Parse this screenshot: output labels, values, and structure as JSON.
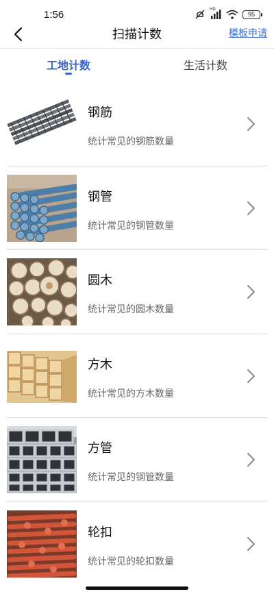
{
  "status_bar": {
    "time": "1:56",
    "battery": "95",
    "network_label": "HD",
    "icons": [
      "mute-icon",
      "signal-icon",
      "wifi-icon",
      "battery-icon"
    ]
  },
  "nav": {
    "back_icon": "chevron-left-icon",
    "title": "扫描计数",
    "template_link": "模板申请"
  },
  "tabs": [
    {
      "label": "工地计数",
      "active": true
    },
    {
      "label": "生活计数",
      "active": false
    }
  ],
  "colors": {
    "accent": "#3a63c4",
    "link": "#3b6fd8"
  },
  "items": [
    {
      "title": "钢筋",
      "desc": "统计常见的钢筋数量",
      "image": "rebar-photo"
    },
    {
      "title": "钢管",
      "desc": "统计常见的钢管数量",
      "image": "steel-pipe-photo"
    },
    {
      "title": "圆木",
      "desc": "统计常见的圆木数量",
      "image": "round-log-photo"
    },
    {
      "title": "方木",
      "desc": "统计常见的方木数量",
      "image": "square-timber-photo"
    },
    {
      "title": "方管",
      "desc": "统计常见的钢管数量",
      "image": "square-tube-photo"
    },
    {
      "title": "轮扣",
      "desc": "统计常见的轮扣数量",
      "image": "wheel-buckle-photo"
    }
  ]
}
